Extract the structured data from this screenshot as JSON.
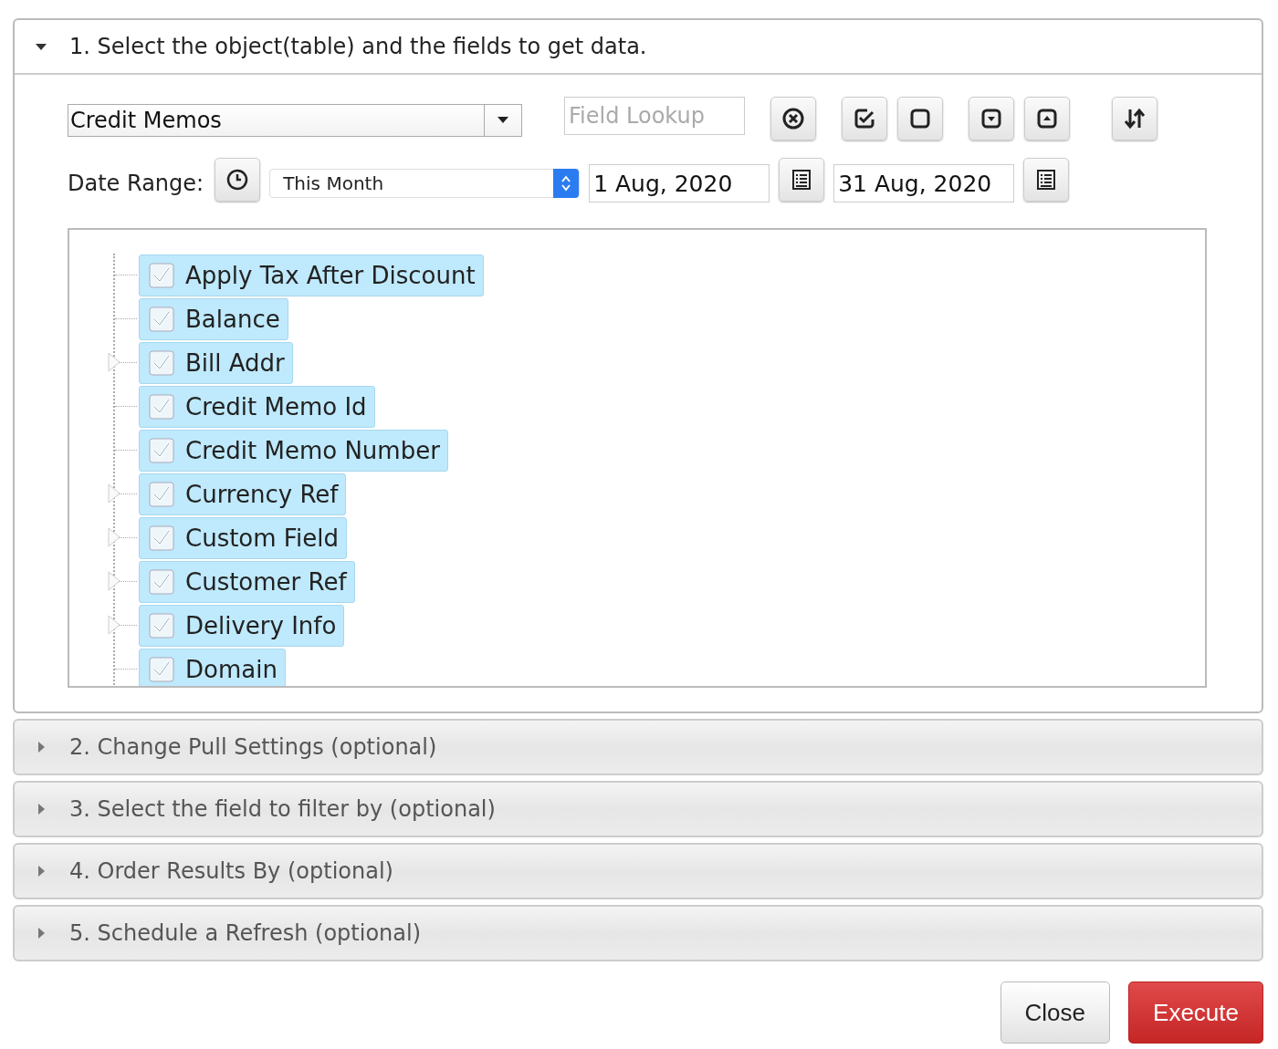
{
  "sections": [
    {
      "title": "1. Select the object(table) and the fields to get data.",
      "expanded": true
    },
    {
      "title": "2. Change Pull Settings (optional)",
      "expanded": false
    },
    {
      "title": "3. Select the field to filter by (optional)",
      "expanded": false
    },
    {
      "title": "4. Order Results By (optional)",
      "expanded": false
    },
    {
      "title": "5. Schedule a Refresh (optional)",
      "expanded": false
    }
  ],
  "object_select": {
    "value": "Credit Memos"
  },
  "field_lookup": {
    "placeholder": "Field Lookup"
  },
  "date_range": {
    "label": "Date Range:",
    "preset": "This Month",
    "start": "1 Aug, 2020",
    "end": "31 Aug, 2020"
  },
  "fields": [
    {
      "label": "Apply Tax After Discount",
      "checked": true,
      "selected": true,
      "expandable": false
    },
    {
      "label": "Balance",
      "checked": true,
      "selected": true,
      "expandable": false
    },
    {
      "label": "Bill Addr",
      "checked": true,
      "selected": true,
      "expandable": true
    },
    {
      "label": "Credit Memo Id",
      "checked": true,
      "selected": true,
      "expandable": false
    },
    {
      "label": "Credit Memo Number",
      "checked": true,
      "selected": true,
      "expandable": false
    },
    {
      "label": "Currency Ref",
      "checked": true,
      "selected": true,
      "expandable": true
    },
    {
      "label": "Custom Field",
      "checked": true,
      "selected": true,
      "expandable": true
    },
    {
      "label": "Customer Ref",
      "checked": true,
      "selected": true,
      "expandable": true
    },
    {
      "label": "Delivery Info",
      "checked": true,
      "selected": true,
      "expandable": true
    },
    {
      "label": "Domain",
      "checked": true,
      "selected": true,
      "expandable": false
    }
  ],
  "buttons": [
    {
      "label": "Close",
      "kind": "default"
    },
    {
      "label": "Execute",
      "kind": "primary"
    }
  ]
}
